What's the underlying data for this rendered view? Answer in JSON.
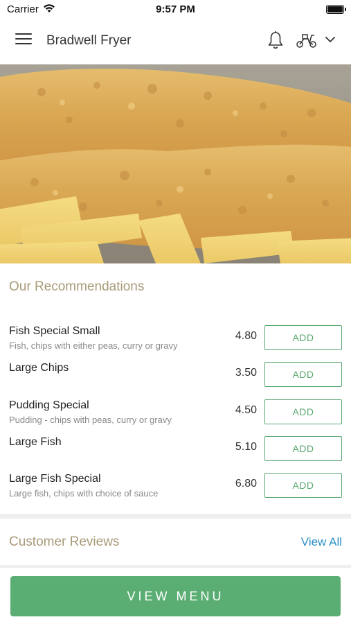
{
  "status_bar": {
    "carrier": "Carrier",
    "time": "9:57 PM"
  },
  "nav": {
    "title": "Bradwell Fryer",
    "icons": [
      "menu-icon",
      "bell-icon",
      "scooter-icon",
      "chevron-down-icon"
    ]
  },
  "recommendations": {
    "title": "Our Recommendations",
    "items": [
      {
        "name": "Fish Special Small",
        "desc": "Fish, chips with either peas, curry or gravy",
        "price": "4.80",
        "add_label": "ADD"
      },
      {
        "name": "Large Chips",
        "desc": "",
        "price": "3.50",
        "add_label": "ADD"
      },
      {
        "name": "Pudding Special",
        "desc": "Pudding - chips with peas, curry or gravy",
        "price": "4.50",
        "add_label": "ADD"
      },
      {
        "name": "Large Fish",
        "desc": "",
        "price": "5.10",
        "add_label": "ADD"
      },
      {
        "name": "Large Fish Special",
        "desc": "Large fish, chips with choice of sauce",
        "price": "6.80",
        "add_label": "ADD"
      }
    ]
  },
  "reviews": {
    "title": "Customer Reviews",
    "view_all": "View All"
  },
  "footer": {
    "view_menu": "VIEW MENU"
  },
  "colors": {
    "accent_green": "#5aad73",
    "section_title": "#a89a78",
    "link_blue": "#2b8fc6"
  }
}
